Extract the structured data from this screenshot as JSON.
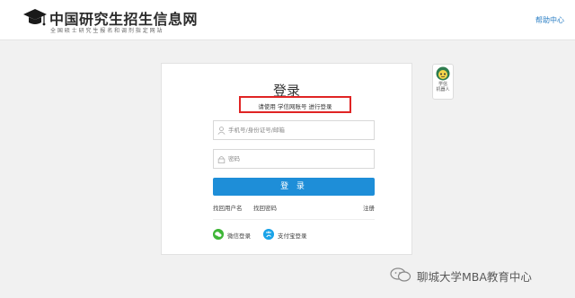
{
  "header": {
    "site_title": "中国研究生招生信息网",
    "site_subtitle": "全国硕士研究生报名和调剂指定网站",
    "help_link": "帮助中心"
  },
  "login": {
    "title": "登录",
    "notice": "请使用 学信网账号 进行登录",
    "username_placeholder": "手机号/身份证号/邮箱",
    "password_placeholder": "密码",
    "submit_label": "登 录",
    "recover_username": "找回用户名",
    "recover_password": "找回密码",
    "register": "注册",
    "wechat_login": "微信登录",
    "alipay_login": "支付宝登录"
  },
  "robot": {
    "label_line1": "学信",
    "label_line2": "机器人"
  },
  "watermark": {
    "text": "聊城大学MBA教育中心"
  },
  "colors": {
    "accent": "#1e8ed8",
    "notice_border": "#e02424",
    "wechat": "#3fb638",
    "alipay": "#1aa3e8",
    "link": "#2a7ec4"
  },
  "icons": {
    "logo": "graduation-cap-icon",
    "username": "user-icon",
    "password": "lock-icon",
    "wechat": "wechat-icon",
    "alipay": "alipay-icon",
    "robot": "robot-icon",
    "watermark": "wechat-watermark-icon"
  }
}
